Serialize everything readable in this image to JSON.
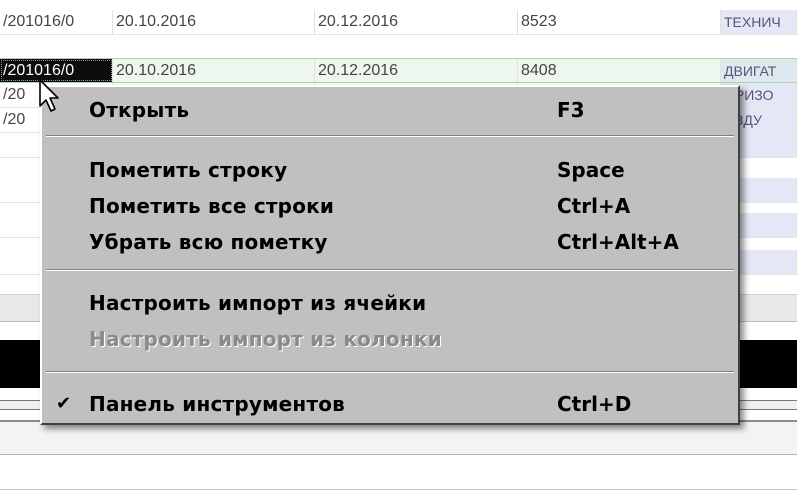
{
  "grid": {
    "rows": [
      {
        "c1": "/201016/0",
        "c2": "20.10.2016",
        "c3": "20.12.2016",
        "c4": "8523",
        "c5": "ТЕХНИЧ"
      },
      {
        "c1": "/201016/0",
        "c2": "20.10.2016",
        "c3": "20.12.2016",
        "c4": "8408",
        "c5": "ДВИГАТ"
      },
      {
        "c1": "/20",
        "c2": "",
        "c3": "",
        "c4": "",
        "c5": "ОРИЗО"
      },
      {
        "c1": "/20",
        "c2": "",
        "c3": "",
        "c4": "",
        "c5": "ОЗДУ"
      }
    ]
  },
  "context_menu": {
    "open": {
      "label": "Открыть",
      "shortcut": "F3"
    },
    "mark_row": {
      "label": "Пометить строку",
      "shortcut": "Space"
    },
    "mark_all": {
      "label": "Пометить все строки",
      "shortcut": "Ctrl+A"
    },
    "unmark_all": {
      "label": "Убрать всю пометку",
      "shortcut": "Ctrl+Alt+A"
    },
    "import_cell": {
      "label": "Настроить импорт из ячейки"
    },
    "import_column": {
      "label": "Настроить импорт из колонки"
    },
    "toolbar": {
      "label": "Панель инструментов",
      "shortcut": "Ctrl+D",
      "check": "✔"
    }
  },
  "colors": {
    "menu_bg": "#c0c0c0",
    "selected_row": "#eef7ee",
    "focus_cell": "#0d0d0d",
    "last_column": "#e4e8f6"
  }
}
